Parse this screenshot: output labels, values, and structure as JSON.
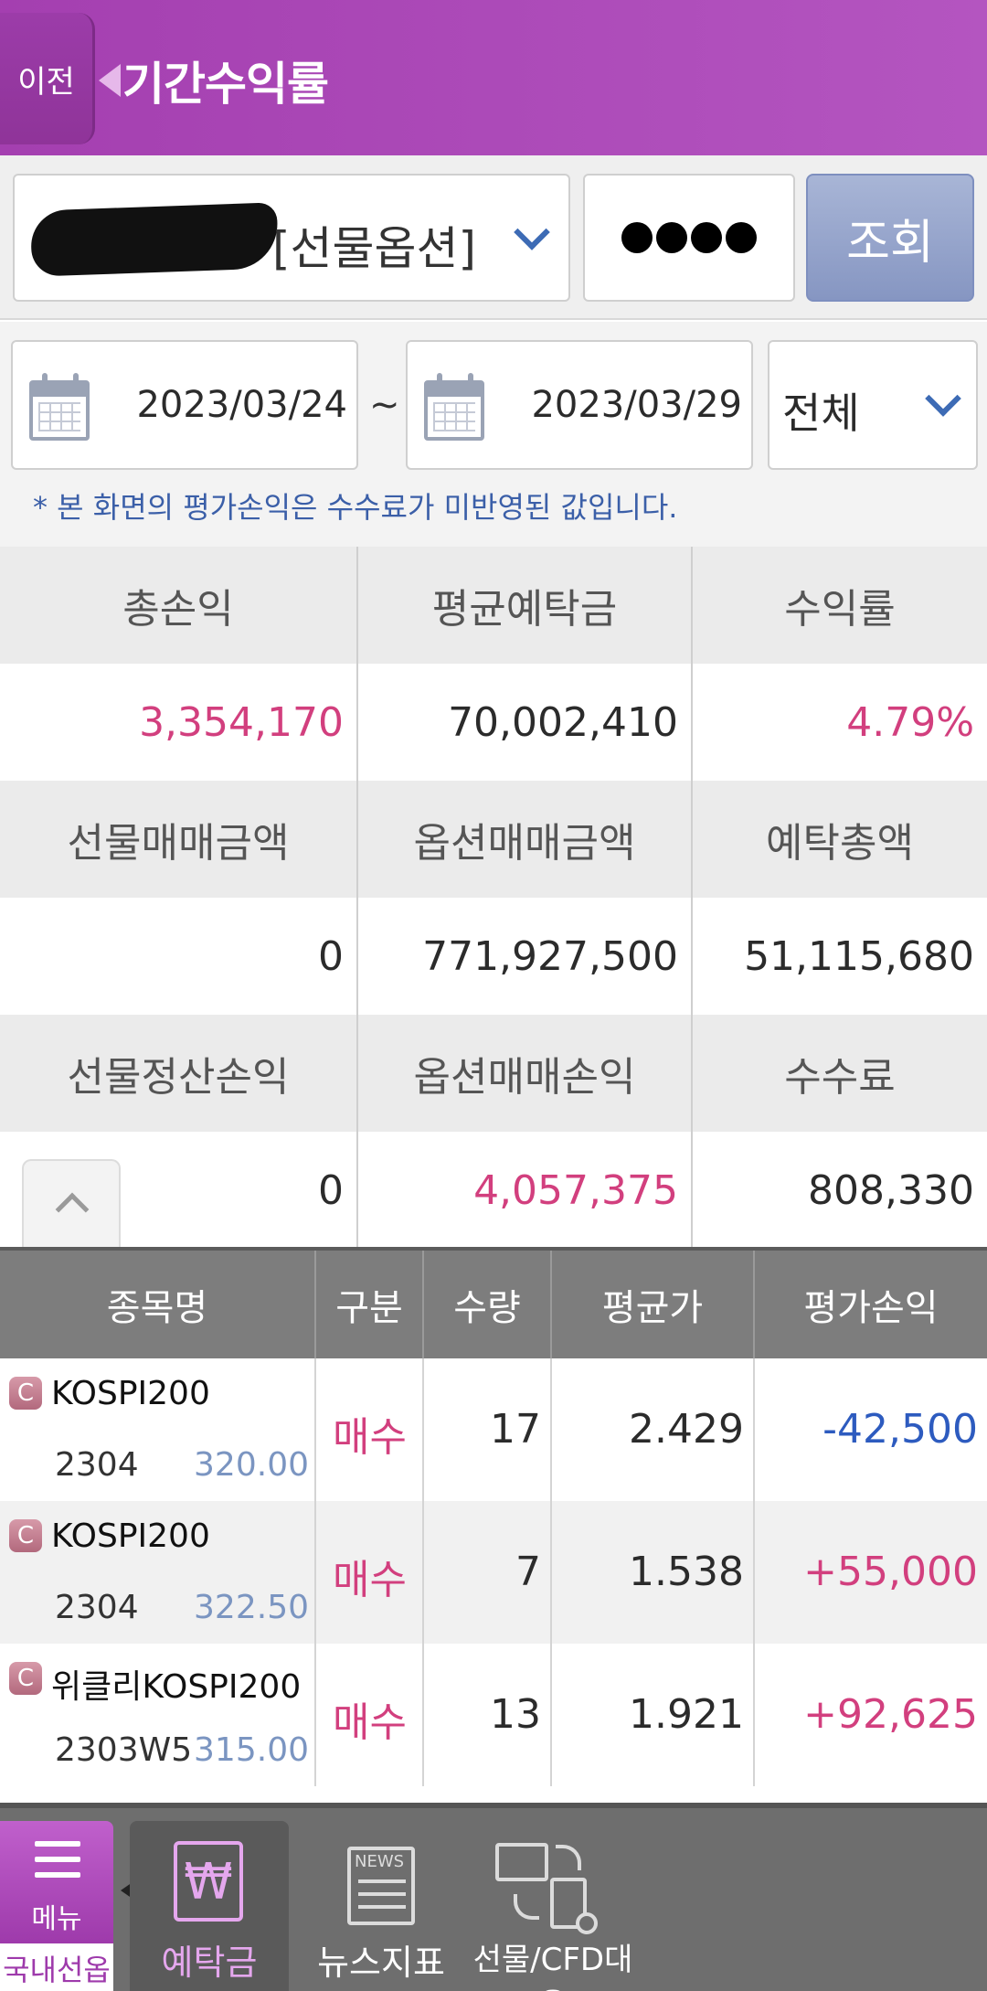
{
  "header": {
    "back_label": "이전",
    "title": "기간수익률"
  },
  "account": {
    "type_label": "[선물옵션]",
    "password_mask": "●●●●",
    "query_button": "조회"
  },
  "period": {
    "start_date": "2023/03/24",
    "separator": "~",
    "end_date": "2023/03/29",
    "filter_value": "전체",
    "notice": "* 본 화면의 평가손익은 수수료가 미반영된 값입니다."
  },
  "summary": {
    "row1_headers": [
      "총손익",
      "평균예탁금",
      "수익률"
    ],
    "row1_values": [
      "3,354,170",
      "70,002,410",
      "4.79%"
    ],
    "row2_headers": [
      "선물매매금액",
      "옵션매매금액",
      "예탁총액"
    ],
    "row2_values": [
      "0",
      "771,927,500",
      "51,115,680"
    ],
    "row3_headers": [
      "선물정산손익",
      "옵션매매손익",
      "수수료"
    ],
    "row3_values": [
      "0",
      "4,057,375",
      "808,330"
    ]
  },
  "holdings": {
    "headers": [
      "종목명",
      "구분",
      "수량",
      "평균가",
      "평가손익"
    ],
    "rows": [
      {
        "badge": "C",
        "name": "KOSPI200",
        "code": "2304",
        "strike": "320.00",
        "side": "매수",
        "qty": "17",
        "avg": "2.429",
        "pnl": "-42,500"
      },
      {
        "badge": "C",
        "name": "KOSPI200",
        "code": "2304",
        "strike": "322.50",
        "side": "매수",
        "qty": "7",
        "avg": "1.538",
        "pnl": "+55,000"
      },
      {
        "badge": "C",
        "name": "위클리KOSPI200",
        "code": "2303W5",
        "strike": "315.00",
        "side": "매수",
        "qty": "13",
        "avg": "1.921",
        "pnl": "+92,625"
      }
    ]
  },
  "bottom_nav": {
    "menu_label": "메뉴",
    "domestic_label": "국내선옵",
    "deposit_label": "예탁금",
    "deposit_icon": "₩",
    "news_label": "뉴스지표",
    "news_icon_text": "NEWS",
    "cfd_label": "선물/CFD대응"
  },
  "colors": {
    "header": "#a43fb0",
    "positive": "#d23f7e",
    "negative": "#2d5bbf"
  }
}
